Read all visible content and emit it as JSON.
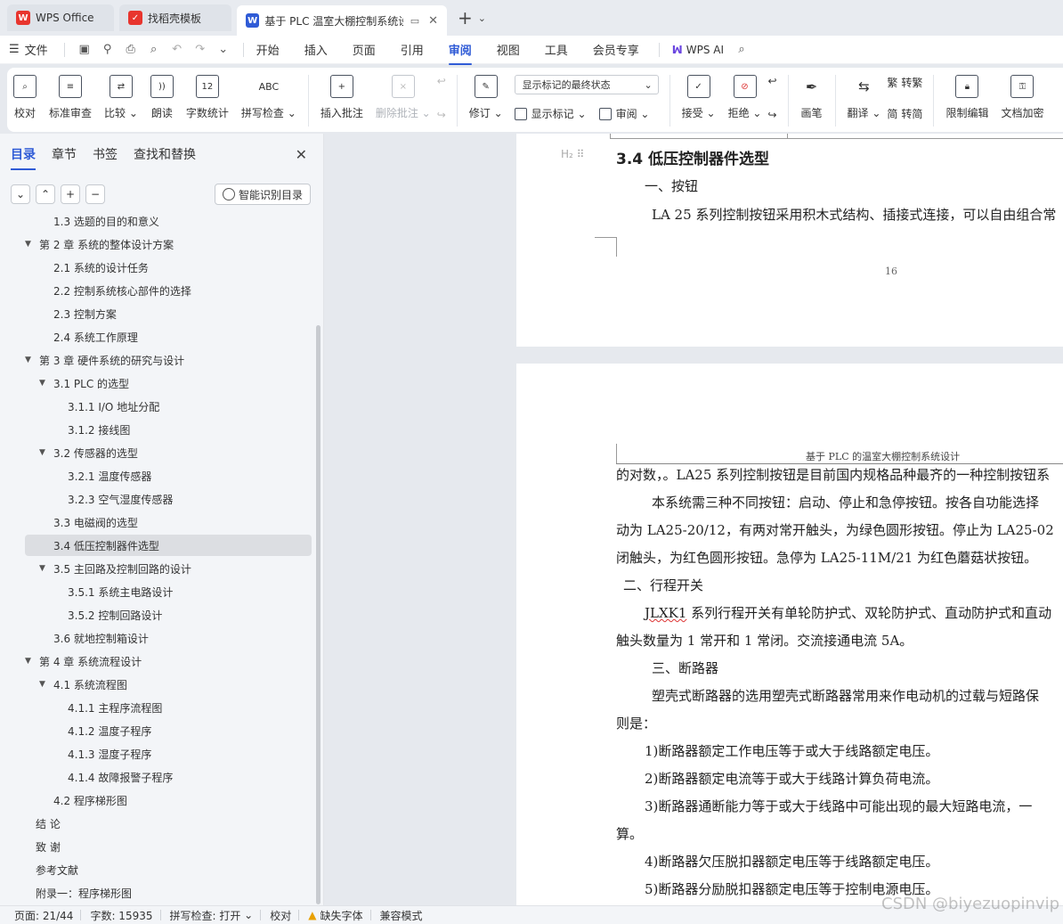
{
  "tabs": [
    {
      "label": "WPS Office",
      "logo": "W",
      "color": "#e8352e"
    },
    {
      "label": "找稻壳模板",
      "logo": "稻",
      "color": "#e8352e"
    },
    {
      "label": "基于 PLC 温室大棚控制系统设",
      "logo": "W",
      "color": "#2f5bd6"
    }
  ],
  "menu": {
    "file": "文件",
    "tabs": [
      "开始",
      "插入",
      "页面",
      "引用",
      "审阅",
      "视图",
      "工具",
      "会员专享"
    ],
    "active_tab": "审阅",
    "wps_ai": "WPS AI"
  },
  "ribbon": {
    "proof": "校对",
    "std_review": "标准审查",
    "compare": "比较",
    "read_aloud": "朗读",
    "word_count": "字数统计",
    "spell_check": "拼写检查",
    "insert_comment": "插入批注",
    "delete_comment": "删除批注",
    "revise": "修订",
    "display_select": "显示标记的最终状态",
    "show_markup": "显示标记",
    "review": "审阅",
    "accept": "接受",
    "reject": "拒绝",
    "pen": "画笔",
    "translate": "翻译",
    "to_traditional": "转繁",
    "to_simplified": "转简",
    "restrict_edit": "限制编辑",
    "doc_encrypt": "文档加密"
  },
  "nav": {
    "tabs": [
      "目录",
      "章节",
      "书签",
      "查找和替换"
    ],
    "active": "目录",
    "smart_btn": "智能识别目录",
    "items": [
      {
        "text": "1.3  选题的目的和意义",
        "level": 2,
        "caret": "",
        "sel": false
      },
      {
        "text": "第 2 章  系统的整体设计方案",
        "level": 1,
        "caret": "▼",
        "sel": false
      },
      {
        "text": "2.1 系统的设计任务",
        "level": 2,
        "caret": "",
        "sel": false
      },
      {
        "text": "2.2  控制系统核心部件的选择",
        "level": 2,
        "caret": "",
        "sel": false
      },
      {
        "text": "2.3 控制方案",
        "level": 2,
        "caret": "",
        "sel": false
      },
      {
        "text": "2.4 系统工作原理",
        "level": 2,
        "caret": "",
        "sel": false
      },
      {
        "text": "第 3 章  硬件系统的研究与设计",
        "level": 1,
        "caret": "▼",
        "sel": false
      },
      {
        "text": "3.1 PLC 的选型",
        "level": 2,
        "caret": "▼",
        "sel": false
      },
      {
        "text": "3.1.1 I/O 地址分配",
        "level": 3,
        "caret": "",
        "sel": false
      },
      {
        "text": "3.1.2  接线图",
        "level": 3,
        "caret": "",
        "sel": false
      },
      {
        "text": "3.2  传感器的选型",
        "level": 2,
        "caret": "▼",
        "sel": false
      },
      {
        "text": "3.2.1 温度传感器",
        "level": 3,
        "caret": "",
        "sel": false
      },
      {
        "text": "3.2.3  空气湿度传感器",
        "level": 3,
        "caret": "",
        "sel": false
      },
      {
        "text": "3.3  电磁阀的选型",
        "level": 2,
        "caret": "",
        "sel": false
      },
      {
        "text": "3.4 低压控制器件选型",
        "level": 2,
        "caret": "",
        "sel": true
      },
      {
        "text": "3.5 主回路及控制回路的设计",
        "level": 2,
        "caret": "▼",
        "sel": false
      },
      {
        "text": "3.5.1  系统主电路设计",
        "level": 3,
        "caret": "",
        "sel": false
      },
      {
        "text": "3.5.2  控制回路设计",
        "level": 3,
        "caret": "",
        "sel": false
      },
      {
        "text": "3.6  就地控制箱设计",
        "level": 2,
        "caret": "",
        "sel": false
      },
      {
        "text": "第 4 章  系统流程设计",
        "level": 1,
        "caret": "▼",
        "sel": false
      },
      {
        "text": "4.1 系统流程图",
        "level": 2,
        "caret": "▼",
        "sel": false
      },
      {
        "text": "4.1.1  主程序流程图",
        "level": 3,
        "caret": "",
        "sel": false
      },
      {
        "text": "4.1.2  温度子程序",
        "level": 3,
        "caret": "",
        "sel": false
      },
      {
        "text": "4.1.3  湿度子程序",
        "level": 3,
        "caret": "",
        "sel": false
      },
      {
        "text": "4.1.4  故障报警子程序",
        "level": 3,
        "caret": "",
        "sel": false
      },
      {
        "text": "4.2 程序梯形图",
        "level": 2,
        "caret": "",
        "sel": false
      },
      {
        "text": "结   论",
        "level": 1,
        "caret": "",
        "sel": false
      },
      {
        "text": "致   谢",
        "level": 1,
        "caret": "",
        "sel": false
      },
      {
        "text": "参考文献",
        "level": 1,
        "caret": "",
        "sel": false
      },
      {
        "text": "附录一：程序梯形图",
        "level": 1,
        "caret": "",
        "sel": false
      }
    ]
  },
  "doc": {
    "page1": {
      "heading_marker": "H₂",
      "heading": "3.4 低压控制器件选型",
      "sub1": "一、按钮",
      "para1": "LA 25 系列控制按钮采用积木式结构、插接式连接，可以自由组合常",
      "page_number": "16"
    },
    "page2": {
      "running_header": "基于 PLC 的温室大棚控制系统设计",
      "lines": [
        "的对数，。LA25 系列控制按钮是目前国内规格品种最齐的一种控制按钮系",
        "本系统需三种不同按钮：启动、停止和急停按钮。按各自功能选择",
        "动为 LA25-20/12，有两对常开触头，为绿色圆形按钮。停止为 LA25-02",
        "闭触头，为红色圆形按钮。急停为 LA25-11M/21 为红色蘑菇状按钮。",
        "二、行程开关",
        "JLXK1 系列行程开关有单轮防护式、双轮防护式、直动防护式和直动",
        "触头数量为 1 常开和 1 常闭。交流接通电流 5A。",
        "三、断路器",
        "塑壳式断路器的选用塑壳式断路器常用来作电动机的过载与短路保",
        "则是：",
        "1)断路器额定工作电压等于或大于线路额定电压。",
        "2)断路器额定电流等于或大于线路计算负荷电流。",
        "3)断路器通断能力等于或大于线路中可能出现的最大短路电流，一",
        "算。",
        "4)断路器欠压脱扣器额定电压等于线路额定电压。",
        "5)断路器分励脱扣器额定电压等于控制电源电压。"
      ]
    }
  },
  "status": {
    "page": "页面: 21/44",
    "words": "字数: 15935",
    "spell": "拼写检查: 打开",
    "proof": "校对",
    "missing_font": "缺失字体",
    "compat": "兼容模式"
  },
  "watermark": "CSDN @biyezuopinvip"
}
